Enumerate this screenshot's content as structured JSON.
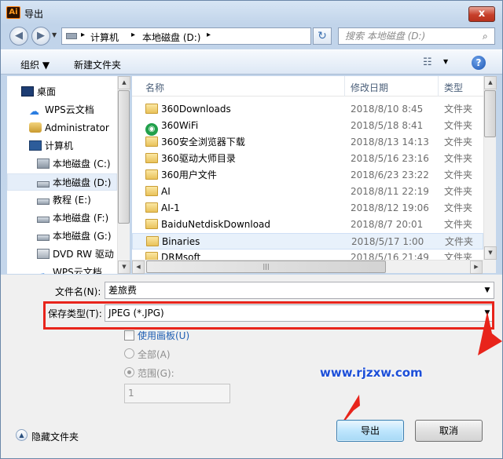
{
  "window": {
    "title": "导出",
    "app_icon": "Ai",
    "close_glyph": "x"
  },
  "address_bar": {
    "breadcrumbs": [
      "计算机",
      "本地磁盘 (D:)"
    ],
    "search_placeholder": "搜索 本地磁盘 (D:)"
  },
  "toolbar": {
    "organize_label": "组织 ▼",
    "new_folder_label": "新建文件夹"
  },
  "nav_pane": {
    "items": [
      {
        "label": "桌面",
        "icon": "desktop-icon"
      },
      {
        "label": "WPS云文档",
        "icon": "cloud-icon"
      },
      {
        "label": "Administrator",
        "icon": "user-icon"
      },
      {
        "label": "计算机",
        "icon": "computer-icon"
      },
      {
        "label": "本地磁盘 (C:)",
        "icon": "system-drive-icon"
      },
      {
        "label": "本地磁盘 (D:)",
        "icon": "drive-icon"
      },
      {
        "label": "教程 (E:)",
        "icon": "drive-icon"
      },
      {
        "label": "本地磁盘 (F:)",
        "icon": "drive-icon"
      },
      {
        "label": "本地磁盘 (G:)",
        "icon": "drive-icon"
      },
      {
        "label": "DVD RW 驱动",
        "icon": "dvd-drive-icon"
      },
      {
        "label": "WPS云文档",
        "icon": "cloud-icon"
      }
    ],
    "selected_index": 5
  },
  "file_list": {
    "columns": {
      "name": "名称",
      "date": "修改日期",
      "type": "类型"
    },
    "rows": [
      {
        "name": "360Downloads",
        "date": "2018/8/10 8:45",
        "type": "文件夹",
        "icon": "folder-icon"
      },
      {
        "name": "360WiFi",
        "date": "2018/5/18 8:41",
        "type": "文件夹",
        "icon": "wifi-icon"
      },
      {
        "name": "360安全浏览器下载",
        "date": "2018/8/13 14:13",
        "type": "文件夹",
        "icon": "folder-icon"
      },
      {
        "name": "360驱动大师目录",
        "date": "2018/5/16 23:16",
        "type": "文件夹",
        "icon": "folder-icon"
      },
      {
        "name": "360用户文件",
        "date": "2018/6/23 23:22",
        "type": "文件夹",
        "icon": "folder-icon"
      },
      {
        "name": "AI",
        "date": "2018/8/11 22:19",
        "type": "文件夹",
        "icon": "folder-icon"
      },
      {
        "name": "AI-1",
        "date": "2018/8/12 19:06",
        "type": "文件夹",
        "icon": "folder-icon"
      },
      {
        "name": "BaiduNetdiskDownload",
        "date": "2018/8/7 20:01",
        "type": "文件夹",
        "icon": "folder-icon"
      },
      {
        "name": "Binaries",
        "date": "2018/5/17 1:00",
        "type": "文件夹",
        "icon": "folder-icon"
      },
      {
        "name": "DRMsoft",
        "date": "2018/5/16 21:49",
        "type": "文件夹",
        "icon": "folder-icon"
      }
    ],
    "hover_index": 8
  },
  "form": {
    "filename_label": "文件名(N):",
    "filename_value": "差旅费",
    "filetype_label": "保存类型(T):",
    "filetype_value": "JPEG (*.JPG)",
    "use_artboards_label": "使用画板(U)",
    "all_label": "全部(A)",
    "range_label": "范围(G):",
    "range_value": "1"
  },
  "buttons": {
    "export_label": "导出",
    "cancel_label": "取消",
    "hide_folders_label": "隐藏文件夹"
  },
  "watermark": "www.rjzxw.com",
  "colors": {
    "accent": "#e8241b",
    "selection": "#e5eef9",
    "link": "#1d4fd8"
  }
}
